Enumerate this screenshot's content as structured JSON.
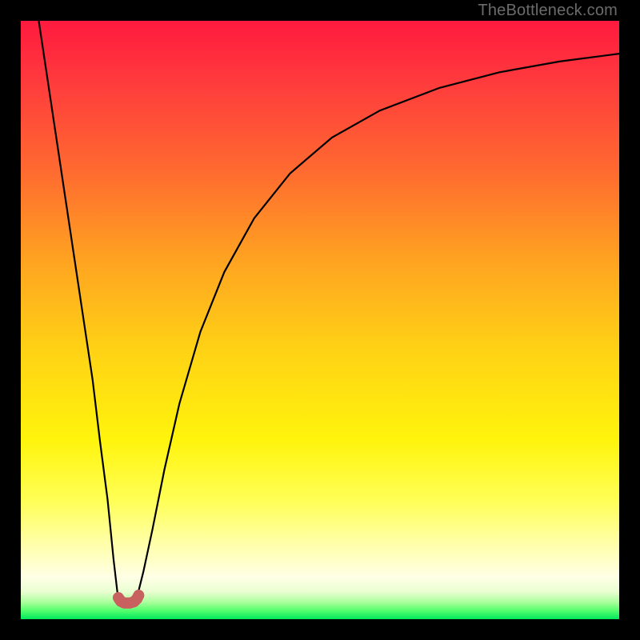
{
  "watermark": "TheBottleneck.com",
  "chart_data": {
    "type": "line",
    "title": "",
    "xlabel": "",
    "ylabel": "",
    "xlim": [
      0,
      100
    ],
    "ylim": [
      0,
      100
    ],
    "background_gradient": {
      "stops": [
        {
          "offset": 0.0,
          "color": "#ff1a3f"
        },
        {
          "offset": 0.1,
          "color": "#ff3a3d"
        },
        {
          "offset": 0.25,
          "color": "#ff6a30"
        },
        {
          "offset": 0.4,
          "color": "#ffa321"
        },
        {
          "offset": 0.55,
          "color": "#ffd215"
        },
        {
          "offset": 0.7,
          "color": "#fff40c"
        },
        {
          "offset": 0.8,
          "color": "#ffff55"
        },
        {
          "offset": 0.88,
          "color": "#ffffb0"
        },
        {
          "offset": 0.93,
          "color": "#ffffe6"
        },
        {
          "offset": 0.955,
          "color": "#e8ffd0"
        },
        {
          "offset": 0.972,
          "color": "#a8ff9a"
        },
        {
          "offset": 0.985,
          "color": "#58ff70"
        },
        {
          "offset": 1.0,
          "color": "#00e85a"
        }
      ]
    },
    "series": [
      {
        "name": "curve",
        "color": "#000000",
        "points": [
          {
            "x": 3.0,
            "y": 100.0
          },
          {
            "x": 4.5,
            "y": 90.0
          },
          {
            "x": 6.0,
            "y": 80.0
          },
          {
            "x": 7.5,
            "y": 70.0
          },
          {
            "x": 9.0,
            "y": 60.0
          },
          {
            "x": 10.5,
            "y": 50.0
          },
          {
            "x": 12.0,
            "y": 40.0
          },
          {
            "x": 13.2,
            "y": 30.0
          },
          {
            "x": 14.5,
            "y": 20.0
          },
          {
            "x": 15.5,
            "y": 10.0
          },
          {
            "x": 16.2,
            "y": 4.0
          },
          {
            "x": 17.0,
            "y": 2.8
          },
          {
            "x": 18.5,
            "y": 2.8
          },
          {
            "x": 19.5,
            "y": 4.0
          },
          {
            "x": 20.5,
            "y": 8.0
          },
          {
            "x": 22.0,
            "y": 15.0
          },
          {
            "x": 24.0,
            "y": 25.0
          },
          {
            "x": 26.5,
            "y": 36.0
          },
          {
            "x": 30.0,
            "y": 48.0
          },
          {
            "x": 34.0,
            "y": 58.0
          },
          {
            "x": 39.0,
            "y": 67.0
          },
          {
            "x": 45.0,
            "y": 74.5
          },
          {
            "x": 52.0,
            "y": 80.5
          },
          {
            "x": 60.0,
            "y": 85.0
          },
          {
            "x": 70.0,
            "y": 88.8
          },
          {
            "x": 80.0,
            "y": 91.4
          },
          {
            "x": 90.0,
            "y": 93.2
          },
          {
            "x": 100.0,
            "y": 94.5
          }
        ]
      },
      {
        "name": "marker",
        "type": "marker",
        "color": "#c86060",
        "points": [
          {
            "x": 16.3,
            "y": 3.6
          },
          {
            "x": 16.7,
            "y": 3.0
          },
          {
            "x": 17.3,
            "y": 2.7
          },
          {
            "x": 18.2,
            "y": 2.7
          },
          {
            "x": 18.9,
            "y": 2.9
          },
          {
            "x": 19.4,
            "y": 3.4
          },
          {
            "x": 19.7,
            "y": 4.0
          }
        ]
      }
    ]
  }
}
